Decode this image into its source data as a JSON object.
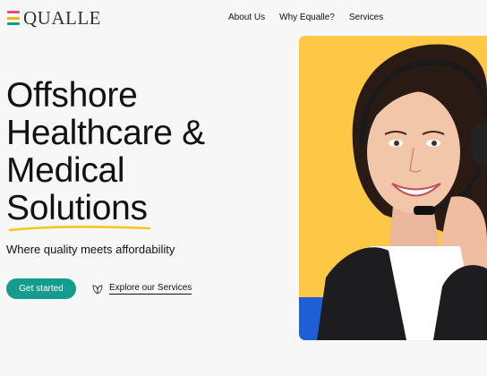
{
  "brand": {
    "name": "QUALLE",
    "bar_colors": [
      "#e64b7c",
      "#f4b400",
      "#149c8f"
    ]
  },
  "nav": {
    "items": [
      "About Us",
      "Why Equalle?",
      "Services"
    ]
  },
  "hero": {
    "title_lines": [
      "Offshore",
      "Healthcare &",
      "Medical",
      "Solutions"
    ],
    "subtitle": "Where quality meets affordability",
    "primary_cta": "Get started",
    "secondary_cta": "Explore our Services"
  },
  "colors": {
    "accent": "#149c8f",
    "highlight": "#f5c518",
    "photo_bg": "#fcc846",
    "photo_accent": "#1f5fd6"
  },
  "icons": {
    "secondary_cta_icon": "leaf-icon",
    "photo": "call-center-agent-headset"
  }
}
